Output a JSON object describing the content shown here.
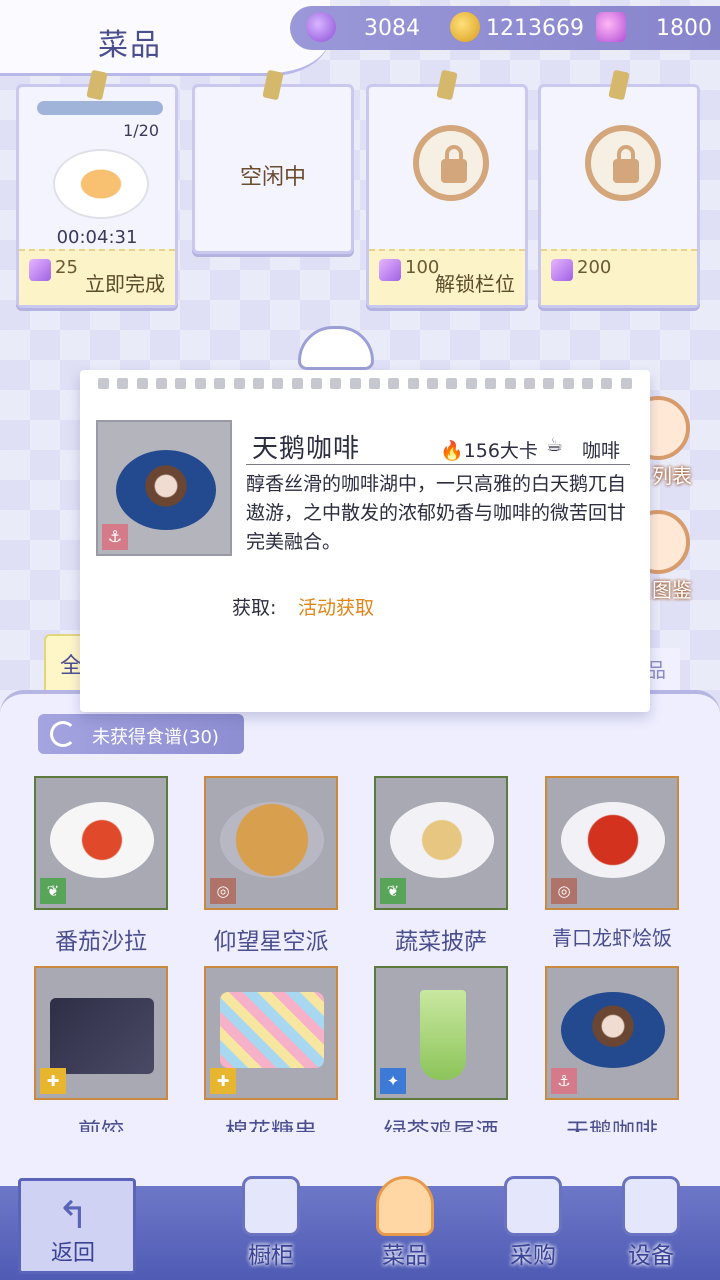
{
  "header": {
    "title": "菜品",
    "currencies": [
      {
        "icon": "purple-gem-icon",
        "value": "3084"
      },
      {
        "icon": "gold-coin-icon",
        "value": "1213669"
      },
      {
        "icon": "swan-gem-plus-icon",
        "value": "1800"
      }
    ]
  },
  "stations": [
    {
      "progress": "1/20",
      "timer": "00:04:31",
      "cost": "25",
      "action": "立即完成"
    },
    {
      "status": "空闲中"
    },
    {
      "cost": "100",
      "action": "解锁栏位"
    },
    {
      "cost": "200"
    }
  ],
  "side_buttons": {
    "list_label": "列表",
    "album_label": "图鉴"
  },
  "popup": {
    "name": "天鹅咖啡",
    "calories": "156大卡",
    "category": "咖啡",
    "description": "醇香丝滑的咖啡湖中，一只高雅的白天鹅兀自遨游，之中散发的浓郁奶香与咖啡的微苦回甘完美融合。",
    "source_label": "获取:",
    "source_value": "活动获取"
  },
  "tabs": {
    "all": "全",
    "right": "品"
  },
  "filter": {
    "label": "未获得食谱(30)"
  },
  "dishes": [
    {
      "name": "番茄沙拉",
      "tag": "leaf-icon"
    },
    {
      "name": "仰望星空派",
      "tag": "snail-icon"
    },
    {
      "name": "蔬菜披萨",
      "tag": "leaf-icon"
    },
    {
      "name": "青口龙虾烩饭",
      "tag": "snail-icon"
    },
    {
      "name": "煎饺",
      "tag": "puzzle-icon"
    },
    {
      "name": "棉花糖串",
      "tag": "puzzle-icon"
    },
    {
      "name": "绿茶鸡尾酒",
      "tag": "bulb-icon"
    },
    {
      "name": "天鹅咖啡",
      "tag": "anchor-icon"
    }
  ],
  "nav": {
    "back": "返回",
    "items": [
      "橱柜",
      "菜品",
      "采购",
      "设备"
    ]
  },
  "colors": {
    "accent": "#4b4e8e",
    "source_orange": "#e08416"
  }
}
